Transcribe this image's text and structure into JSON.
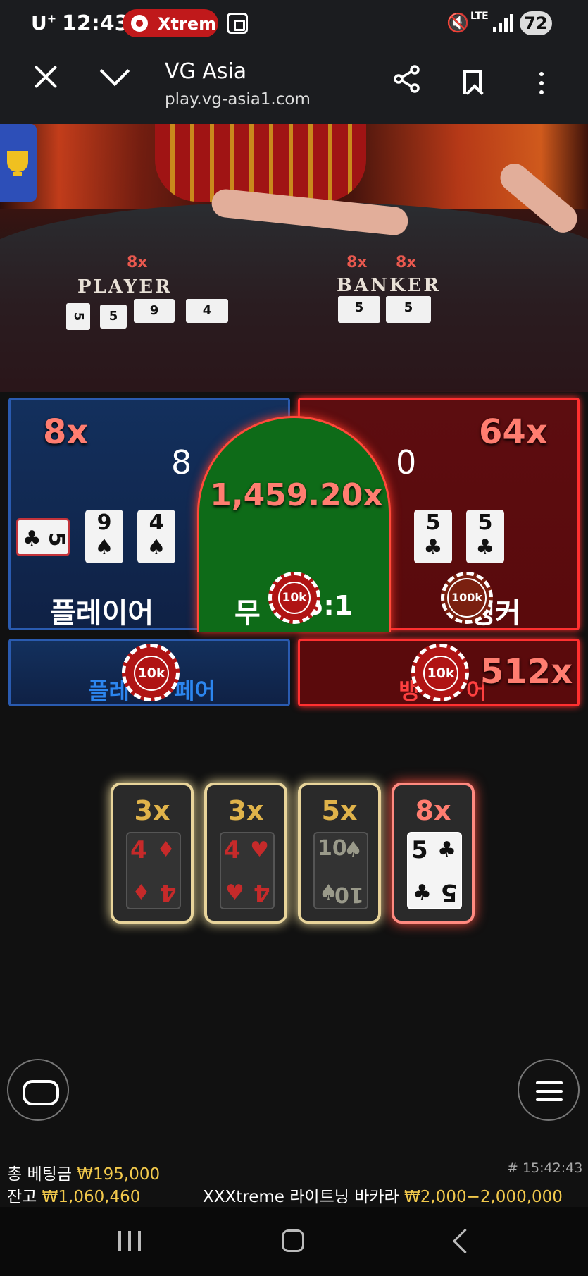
{
  "status_bar": {
    "carrier": "U",
    "carrier_sup": "+",
    "time": "12:43",
    "app_pill": "Xtrem",
    "network": "LTE",
    "battery": "72"
  },
  "browser": {
    "title": "VG Asia",
    "url": "play.vg-asia1.com"
  },
  "video": {
    "player_label": "PLAYER",
    "banker_label": "BANKER",
    "player_mult": "8x",
    "banker_mult1": "8x",
    "banker_mult2": "8x",
    "player_cards": [
      "5",
      "9",
      "4"
    ],
    "banker_cards": [
      "5",
      "5"
    ]
  },
  "bets": {
    "player": {
      "mult": "8x",
      "score": "8",
      "name": "플레이어",
      "cards": [
        {
          "rank": "5",
          "suit": "♣"
        },
        {
          "rank": "9",
          "suit": "♠"
        },
        {
          "rank": "4",
          "suit": "♠"
        }
      ]
    },
    "tie": {
      "mult": "1,459.20x",
      "name": "무",
      "payout": "5:1",
      "chip": "10k"
    },
    "banker": {
      "mult": "64x",
      "score": "0",
      "name": "뱅커",
      "cards": [
        {
          "rank": "5",
          "suit": "♣"
        },
        {
          "rank": "5",
          "suit": "♣"
        }
      ],
      "chip": "100k"
    },
    "player_pair": {
      "name_left": "플레",
      "name_right": "페어",
      "chip": "10k"
    },
    "banker_pair": {
      "name_left": "뱅",
      "name_right": "어",
      "mult": "512x",
      "chip": "10k"
    }
  },
  "lightning_cards": [
    {
      "mult": "3x",
      "rank": "4",
      "suit": "♦",
      "color": "#c62a2a"
    },
    {
      "mult": "3x",
      "rank": "4",
      "suit": "♥",
      "color": "#c62a2a"
    },
    {
      "mult": "5x",
      "rank": "10",
      "suit": "♠",
      "color": "#9a9a8a"
    },
    {
      "mult": "8x",
      "rank": "5",
      "suit": "♣",
      "color": "#111111"
    }
  ],
  "info": {
    "total_bet_label": "총 베팅금",
    "total_bet": "₩195,000",
    "balance_label": "잔고",
    "balance": "₩1,060,460",
    "round_id": "# 15:42:43",
    "game_name": "XXXtreme 라이트닝 바카라",
    "limits": "₩2,000−2,000,000"
  },
  "icons": [
    "trophy-icon",
    "chat-icon",
    "menu-icon",
    "close-icon",
    "chevron-down-icon",
    "share-icon",
    "bookmark-icon",
    "more-icon"
  ]
}
